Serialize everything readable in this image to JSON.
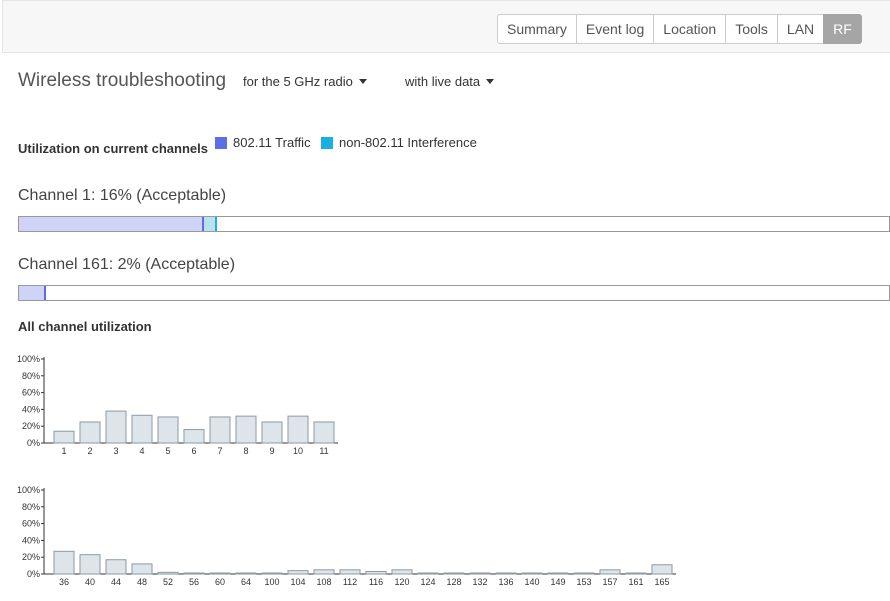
{
  "tabs": [
    {
      "label": "Summary",
      "active": false
    },
    {
      "label": "Event log",
      "active": false
    },
    {
      "label": "Location",
      "active": false
    },
    {
      "label": "Tools",
      "active": false
    },
    {
      "label": "LAN",
      "active": false
    },
    {
      "label": "RF",
      "active": true
    }
  ],
  "title": "Wireless troubleshooting",
  "radio_dropdown": "for the 5 GHz radio",
  "data_dropdown": "with live data",
  "utilization_heading": "Utilization on current channels",
  "legend": {
    "traffic_label": "802.11 Traffic",
    "traffic_color": "#5b6ee6",
    "interference_label": "non-802.11 Interference",
    "interference_color": "#18b0e0"
  },
  "current_channels": [
    {
      "label": "Channel 1: 16% (Acceptable)",
      "traffic_pct": 0.213,
      "interference_pct": 0.015
    },
    {
      "label": "Channel 161: 2% (Acceptable)",
      "traffic_pct": 0.031,
      "interference_pct": 0
    }
  ],
  "all_heading": "All channel utilization",
  "chart_data": [
    {
      "type": "bar",
      "categories": [
        "1",
        "2",
        "3",
        "4",
        "5",
        "6",
        "7",
        "8",
        "9",
        "10",
        "11"
      ],
      "values": [
        14,
        25,
        38,
        33,
        31,
        16,
        31,
        32,
        25,
        32,
        25
      ],
      "yticks": [
        "100%",
        "80%",
        "60%",
        "40%",
        "20%",
        "0%"
      ],
      "ylim": [
        0,
        100
      ],
      "grid": false
    },
    {
      "type": "bar",
      "categories": [
        "36",
        "40",
        "44",
        "48",
        "52",
        "56",
        "60",
        "64",
        "100",
        "104",
        "108",
        "112",
        "116",
        "120",
        "124",
        "128",
        "132",
        "136",
        "140",
        "149",
        "153",
        "157",
        "161",
        "165"
      ],
      "values": [
        27,
        23,
        17,
        12,
        2,
        1,
        0.5,
        0.5,
        0.5,
        4,
        5,
        5,
        3,
        5,
        0.5,
        0.5,
        0.5,
        0.5,
        0.5,
        0.5,
        0.5,
        5,
        0.5,
        11
      ],
      "yticks": [
        "100%",
        "80%",
        "60%",
        "40%",
        "20%",
        "0%"
      ],
      "ylim": [
        0,
        100
      ],
      "grid": false
    }
  ]
}
